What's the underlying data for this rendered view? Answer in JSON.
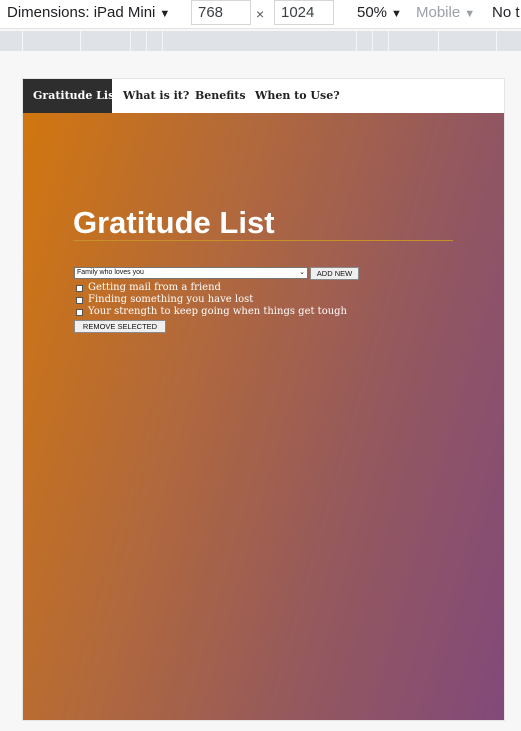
{
  "devtools": {
    "dimensions_label": "Dimensions: iPad Mini",
    "width_value": "768",
    "height_value": "1024",
    "times_symbol": "×",
    "zoom": "50%",
    "mobile": "Mobile",
    "throttle": "No t",
    "caret": "▼"
  },
  "nav": {
    "items": [
      {
        "label": "Gratitude List",
        "active": true
      },
      {
        "label": "What is it?"
      },
      {
        "label": "Benefits"
      },
      {
        "label": "When to Use?"
      }
    ]
  },
  "main": {
    "title": "Gratitude List",
    "select_value": "Family who loves you",
    "add_label": "ADD NEW",
    "items": [
      {
        "label": "Getting mail from a friend",
        "checked": false
      },
      {
        "label": "Finding something you have lost",
        "checked": false
      },
      {
        "label": "Your strength to keep going when things get tough",
        "checked": false
      }
    ],
    "remove_label": "REMOVE SELECTED"
  },
  "colors": {
    "gradient_start": "#d1760f",
    "gradient_end": "#82497a",
    "nav_active": "#2e2e2e"
  }
}
